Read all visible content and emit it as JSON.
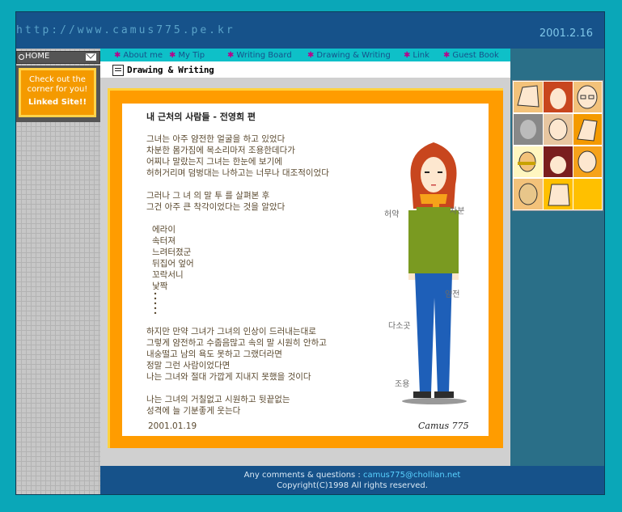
{
  "header": {
    "url_text": "http://www.camus775.pe.kr",
    "date": "2001.2.16"
  },
  "sidebar": {
    "home_label": "HOME",
    "promo_line1": "Check out the",
    "promo_line2": "corner for you!",
    "promo_link": "Linked Site!!"
  },
  "nav": {
    "items": [
      {
        "label": "About me"
      },
      {
        "label": "My Tip"
      },
      {
        "label": "Writing Board"
      },
      {
        "label": "Drawing & Writing"
      },
      {
        "label": "Link"
      },
      {
        "label": "Guest Book"
      }
    ]
  },
  "section": {
    "title": "Drawing & Writing"
  },
  "article": {
    "title": "내 근처의 사람들 - 전영희 편",
    "lines": [
      "그녀는 아주 얌전한 얼굴을 하고 있었다",
      "차분한 몸가짐에 목소리마저 조용한데다가",
      "어찌나 말랐는지 그녀는 한눈에 보기에",
      "허허거리며 덤벙대는 나하고는 너무나 대조적이었다",
      "그러나 그 녀 의  말 투 를 살펴본 후",
      "그건 아주 큰 착각이었다는 것을 알았다",
      "에라이",
      "속터져",
      "느려터졌군",
      "뒤집어 엎어",
      "꼬락서니",
      "낯짝",
      "하지만 만약 그녀가 그녀의 인상이 드러내는대로",
      "그렇게 얌전하고 수줍음많고 속의 말 시원히 안하고",
      "내숭떨고 남의 욕도 못하고 그랬더라면",
      "정말 그런 사람이었다면",
      "나는 그녀와 절대 가깝게 지내지 못했을 것이다",
      "나는 그녀의 거칠없고 시원하고 뒷끝없는",
      "성격에 늘 기분좋게 웃는다"
    ],
    "date": "2001.01.19"
  },
  "figure": {
    "labels": [
      "허약",
      "차분",
      "얌전",
      "다소곳",
      "조용"
    ],
    "signature": "Camus 775"
  },
  "footer": {
    "line1_prefix": "Any comments & questions : ",
    "email": "camus775@chollian.net",
    "line2": "Copyright(C)1998 All rights reserved."
  },
  "colors": {
    "brand_blue": "#16528a",
    "teal": "#0aa7b8",
    "orange": "#ff9c00",
    "link_star": "#b8008a"
  }
}
